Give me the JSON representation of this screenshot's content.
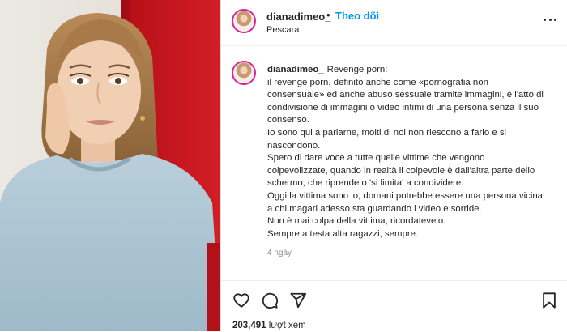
{
  "post": {
    "username": "dianadimeo_",
    "separator": "•",
    "follow_label": "Theo dõi",
    "location": "Pescara",
    "caption_user": "dianadimeo_",
    "caption_lines": [
      "Revenge porn:",
      "il revenge porn, definito anche come «pornografia non",
      "consensuale» ed anche abuso sessuale tramite immagini, è l'atto di",
      "condivisione di immagini o video intimi di una persona senza il suo",
      "consenso.",
      "Io sono qui a parlarne, molti di noi non riescono a farlo e si",
      "nascondono.",
      "Spero di dare voce a tutte quelle vittime che vengono",
      "colpevolizzate, quando in realtà il colpevole è dall'altra parte dello",
      "schermo, che riprende o 'si limita' a condividere.",
      "Oggi la vittima sono io, domani potrebbe essere una persona vicina",
      "a chi magari adesso sta guardando i video e sorride.",
      "Non è mai colpa della vittima, ricordatevelo.",
      "Sempre a testa alta ragazzi, sempre."
    ],
    "time_ago": "4 ngày",
    "view_count": "203,491",
    "views_suffix": "lượt xem"
  },
  "icons": {
    "like": "heart-icon",
    "comment": "comment-icon",
    "share": "send-icon",
    "save": "bookmark-icon",
    "more": "more-options-icon"
  },
  "colors": {
    "follow": "#0095f6",
    "text": "#262626",
    "muted": "#8e8e8e",
    "border": "#dbdbdb",
    "photo_wall_red": "#c8161d"
  }
}
